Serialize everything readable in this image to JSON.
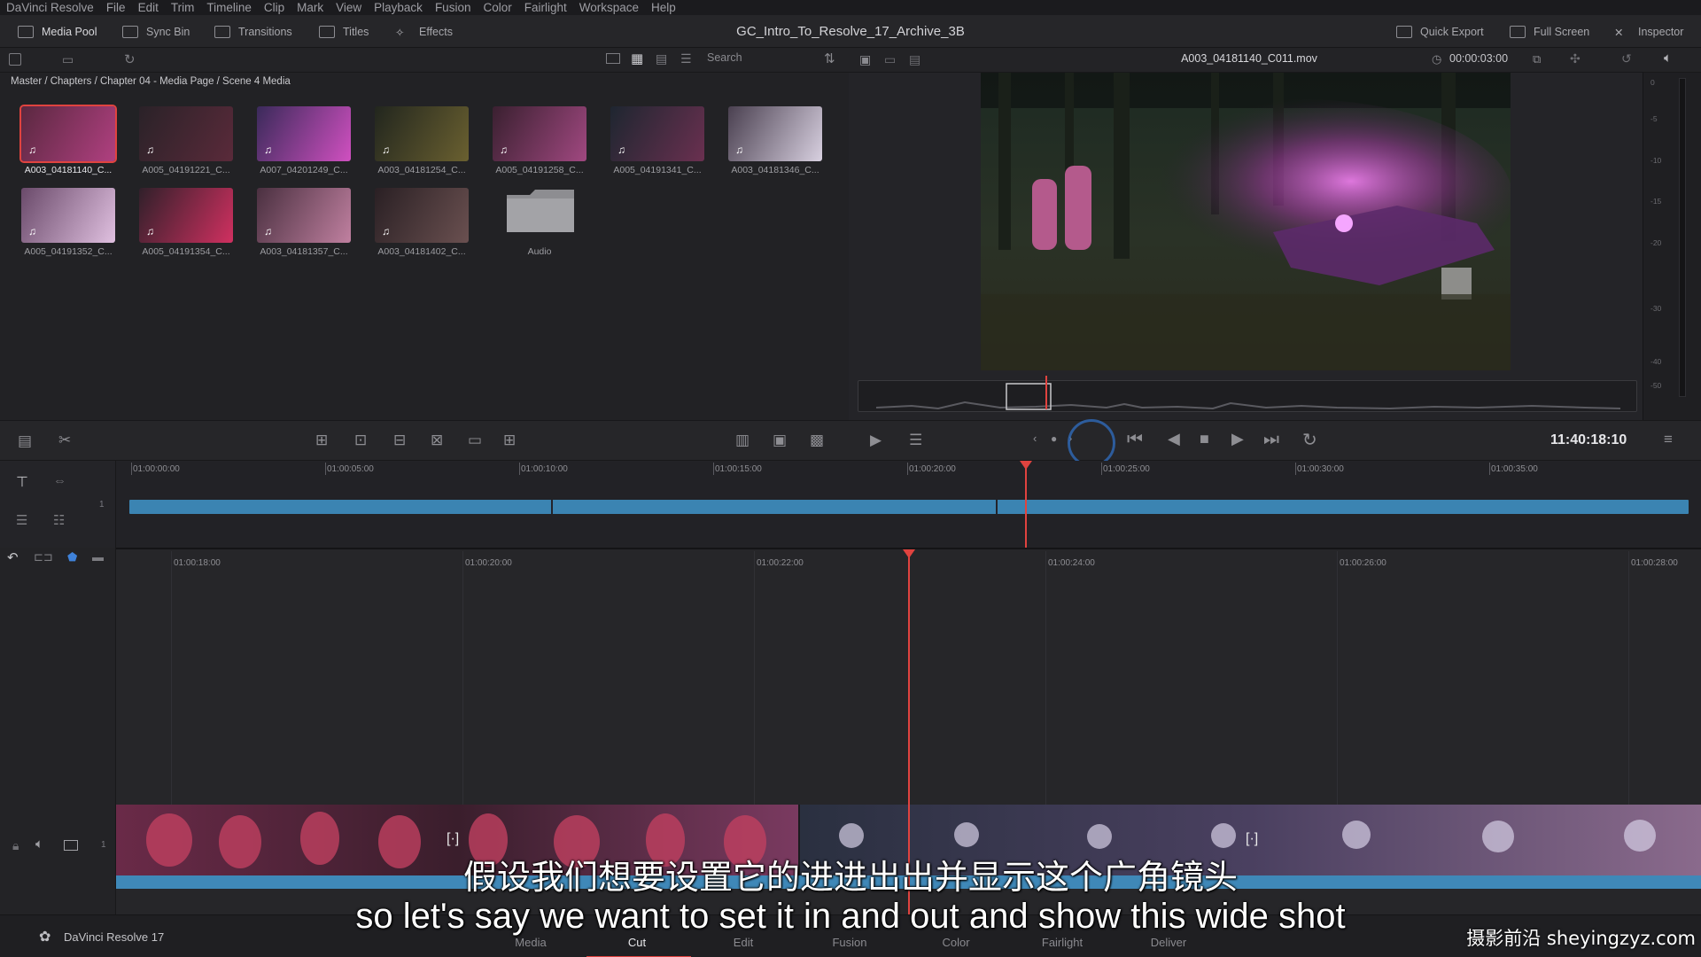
{
  "menu": [
    "DaVinci Resolve",
    "File",
    "Edit",
    "Trim",
    "Timeline",
    "Clip",
    "Mark",
    "View",
    "Playback",
    "Fusion",
    "Color",
    "Fairlight",
    "Workspace",
    "Help"
  ],
  "toolbar": {
    "media_pool": "Media Pool",
    "sync_bin": "Sync Bin",
    "transitions": "Transitions",
    "titles": "Titles",
    "effects": "Effects",
    "project_title": "GC_Intro_To_Resolve_17_Archive_3B",
    "quick_export": "Quick Export",
    "full_screen": "Full Screen",
    "inspector": "Inspector"
  },
  "pool": {
    "search_placeholder": "Search",
    "breadcrumb": "Master / Chapters / Chapter 04 - Media Page / Scene 4 Media",
    "clips": [
      {
        "label": "A003_04181140_C...",
        "selected": true
      },
      {
        "label": "A005_04191221_C..."
      },
      {
        "label": "A007_04201249_C..."
      },
      {
        "label": "A003_04181254_C..."
      },
      {
        "label": "A005_04191258_C..."
      },
      {
        "label": "A005_04191341_C..."
      },
      {
        "label": "A003_04181346_C..."
      },
      {
        "label": "A005_04191352_C..."
      },
      {
        "label": "A005_04191354_C..."
      },
      {
        "label": "A003_04181357_C..."
      },
      {
        "label": "A003_04181402_C..."
      }
    ],
    "folder_label": "Audio"
  },
  "viewer": {
    "clip_name": "A003_04181140_C011.mov",
    "duration": "00:00:03:00",
    "meter_ticks": [
      "0",
      "-5",
      "-10",
      "-15",
      "-20",
      "-30",
      "-40",
      "-50"
    ]
  },
  "transport": {
    "timecode": "11:40:18:10"
  },
  "upper_ruler": [
    "01:00:00:00",
    "01:00:05:00",
    "01:00:10:00",
    "01:00:15:00",
    "01:00:20:00",
    "01:00:25:00",
    "01:00:30:00",
    "01:00:35:00"
  ],
  "lower_ruler": [
    "01:00:18:00",
    "01:00:20:00",
    "01:00:22:00",
    "01:00:24:00",
    "01:00:26:00",
    "01:00:28:00"
  ],
  "track_number": "1",
  "pages": [
    "Media",
    "Cut",
    "Edit",
    "Fusion",
    "Color",
    "Fairlight",
    "Deliver"
  ],
  "active_page": "Cut",
  "app_name": "DaVinci Resolve 17",
  "subtitles": {
    "cn": "假设我们想要设置它的进进出出并显示这个广角镜头",
    "en": "so let's say we want to set it in and out and show this wide shot"
  },
  "watermark": "摄影前沿 sheyingzyz.com",
  "colors": {
    "accent": "#e0433f",
    "track": "#3b84b2"
  }
}
